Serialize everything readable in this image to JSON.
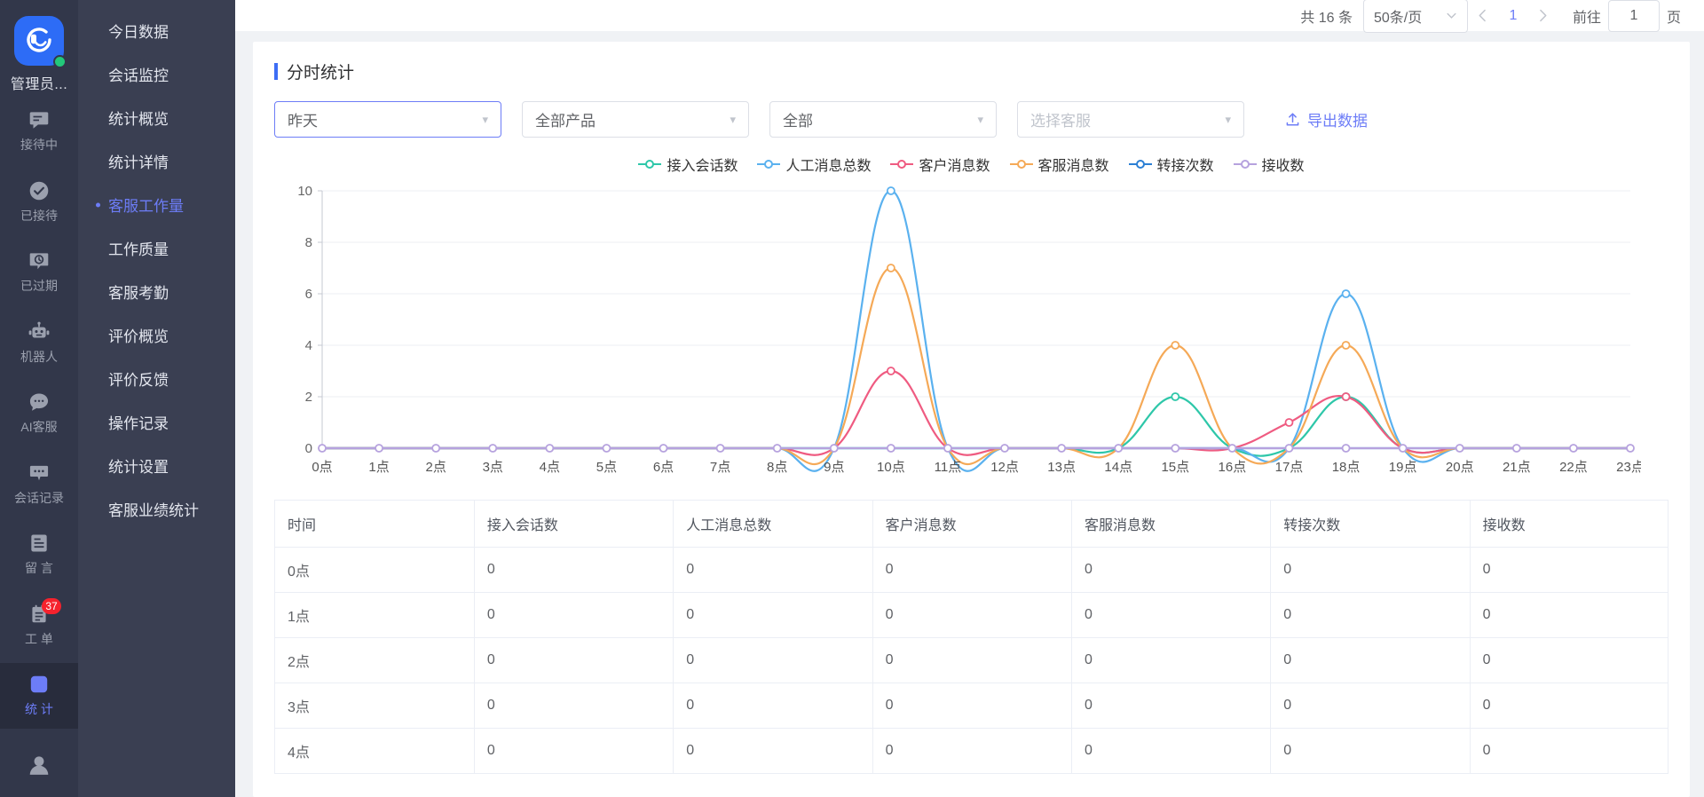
{
  "rail": {
    "user_name": "管理员...",
    "items": [
      {
        "label": "接待中",
        "icon": "chat-bubble-icon",
        "active": false,
        "badge": null
      },
      {
        "label": "已接待",
        "icon": "check-circle-icon",
        "active": false,
        "badge": null
      },
      {
        "label": "已过期",
        "icon": "clock-bubble-icon",
        "active": false,
        "badge": null
      },
      {
        "label": "机器人",
        "icon": "robot-icon",
        "active": false,
        "badge": null
      },
      {
        "label": "AI客服",
        "icon": "chat-dots-icon",
        "active": false,
        "badge": null
      },
      {
        "label": "会话记录",
        "icon": "message-history-icon",
        "active": false,
        "badge": null
      },
      {
        "label": "留 言",
        "icon": "note-icon",
        "active": false,
        "badge": null
      },
      {
        "label": "工 单",
        "icon": "ticket-icon",
        "active": false,
        "badge": "37"
      },
      {
        "label": "统 计",
        "icon": "bar-chart-icon",
        "active": true,
        "badge": null
      }
    ]
  },
  "menu": {
    "items": [
      {
        "label": "今日数据",
        "active": false
      },
      {
        "label": "会话监控",
        "active": false
      },
      {
        "label": "统计概览",
        "active": false
      },
      {
        "label": "统计详情",
        "active": false
      },
      {
        "label": "客服工作量",
        "active": true
      },
      {
        "label": "工作质量",
        "active": false
      },
      {
        "label": "客服考勤",
        "active": false
      },
      {
        "label": "评价概览",
        "active": false
      },
      {
        "label": "评价反馈",
        "active": false
      },
      {
        "label": "操作记录",
        "active": false
      },
      {
        "label": "统计设置",
        "active": false
      },
      {
        "label": "客服业绩统计",
        "active": false
      }
    ]
  },
  "pagination": {
    "total_text": "共 16 条",
    "page_size": "50条/页",
    "prev_icon": "chevron-left-icon",
    "next_icon": "chevron-right-icon",
    "current_page": "1",
    "jump_prefix": "前往",
    "jump_value": "1",
    "jump_suffix": "页"
  },
  "panel": {
    "title": "分时统计",
    "filters": [
      {
        "value": "昨天",
        "placeholder": "",
        "focused": true,
        "is_placeholder": false
      },
      {
        "value": "全部产品",
        "placeholder": "",
        "focused": false,
        "is_placeholder": false
      },
      {
        "value": "全部",
        "placeholder": "",
        "focused": false,
        "is_placeholder": false
      },
      {
        "value": "选择客服",
        "placeholder": "选择客服",
        "focused": false,
        "is_placeholder": true
      }
    ],
    "export_label": "导出数据",
    "export_icon": "upload-icon"
  },
  "chart_data": {
    "type": "line",
    "title": "",
    "xlabel": "",
    "ylabel": "",
    "ylim": [
      0,
      10
    ],
    "yticks": [
      0,
      2,
      4,
      6,
      8,
      10
    ],
    "grid": true,
    "legend_position": "top-center",
    "categories": [
      "0点",
      "1点",
      "2点",
      "3点",
      "4点",
      "5点",
      "6点",
      "7点",
      "8点",
      "9点",
      "10点",
      "11点",
      "12点",
      "13点",
      "14点",
      "15点",
      "16点",
      "17点",
      "18点",
      "19点",
      "20点",
      "21点",
      "22点",
      "23点"
    ],
    "series": [
      {
        "name": "接入会话数",
        "color": "#2ec7a9",
        "values": [
          0,
          0,
          0,
          0,
          0,
          0,
          0,
          0,
          0,
          0,
          0,
          0,
          0,
          0,
          0,
          2,
          0,
          0,
          2,
          0,
          0,
          0,
          0,
          0
        ]
      },
      {
        "name": "人工消息总数",
        "color": "#5ab1ef",
        "values": [
          0,
          0,
          0,
          0,
          0,
          0,
          0,
          0,
          0,
          0,
          10,
          0,
          0,
          0,
          0,
          0,
          0,
          0,
          6,
          0,
          0,
          0,
          0,
          0
        ]
      },
      {
        "name": "客户消息数",
        "color": "#ef5b81",
        "values": [
          0,
          0,
          0,
          0,
          0,
          0,
          0,
          0,
          0,
          0,
          3,
          0,
          0,
          0,
          0,
          0,
          0,
          1,
          2,
          0,
          0,
          0,
          0,
          0
        ]
      },
      {
        "name": "客服消息数",
        "color": "#f5a957",
        "values": [
          0,
          0,
          0,
          0,
          0,
          0,
          0,
          0,
          0,
          0,
          7,
          0,
          0,
          0,
          0,
          4,
          0,
          0,
          4,
          0,
          0,
          0,
          0,
          0
        ]
      },
      {
        "name": "转接次数",
        "color": "#2b7fd4",
        "values": [
          0,
          0,
          0,
          0,
          0,
          0,
          0,
          0,
          0,
          0,
          0,
          0,
          0,
          0,
          0,
          0,
          0,
          0,
          0,
          0,
          0,
          0,
          0,
          0
        ]
      },
      {
        "name": "接收数",
        "color": "#b6a2de",
        "values": [
          0,
          0,
          0,
          0,
          0,
          0,
          0,
          0,
          0,
          0,
          0,
          0,
          0,
          0,
          0,
          0,
          0,
          0,
          0,
          0,
          0,
          0,
          0,
          0
        ]
      }
    ]
  },
  "table": {
    "columns": [
      "时间",
      "接入会话数",
      "人工消息总数",
      "客户消息数",
      "客服消息数",
      "转接次数",
      "接收数"
    ],
    "rows": [
      [
        "0点",
        "0",
        "0",
        "0",
        "0",
        "0",
        "0"
      ],
      [
        "1点",
        "0",
        "0",
        "0",
        "0",
        "0",
        "0"
      ],
      [
        "2点",
        "0",
        "0",
        "0",
        "0",
        "0",
        "0"
      ],
      [
        "3点",
        "0",
        "0",
        "0",
        "0",
        "0",
        "0"
      ],
      [
        "4点",
        "0",
        "0",
        "0",
        "0",
        "0",
        "0"
      ]
    ]
  }
}
